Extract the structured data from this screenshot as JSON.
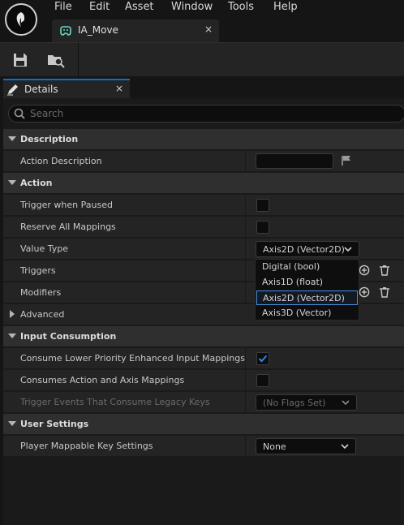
{
  "menu": [
    "File",
    "Edit",
    "Asset",
    "Window",
    "Tools",
    "Help"
  ],
  "asset_tab": {
    "label": "IA_Move",
    "close": "×"
  },
  "details_tab": {
    "label": "Details",
    "close": "×"
  },
  "search": {
    "placeholder": "Search"
  },
  "sections": {
    "description": "Description",
    "action": "Action",
    "advanced": "Advanced",
    "input_consumption": "Input Consumption",
    "user_settings": "User Settings"
  },
  "rows": {
    "action_description": "Action Description",
    "trigger_when_paused": "Trigger when Paused",
    "reserve_all_mappings": "Reserve All Mappings",
    "value_type": "Value Type",
    "triggers": "Triggers",
    "modifiers": "Modifiers",
    "consume_lower": "Consume Lower Priority Enhanced Input Mappings",
    "consumes_action_axis": "Consumes Action and Axis Mappings",
    "trigger_events_legacy": "Trigger Events That Consume Legacy Keys",
    "player_mappable": "Player Mappable Key Settings"
  },
  "values": {
    "action_description": "",
    "trigger_when_paused": false,
    "reserve_all_mappings": false,
    "value_type": "Axis2D (Vector2D)",
    "consume_lower": true,
    "consumes_action_axis": false,
    "trigger_events_legacy": "(No Flags Set)",
    "player_mappable": "None"
  },
  "value_type_options": [
    "Digital (bool)",
    "Axis1D (float)",
    "Axis2D (Vector2D)",
    "Axis3D (Vector)"
  ],
  "value_type_selected": "Axis2D (Vector2D)",
  "colors": {
    "accent": "#0070e0",
    "check": "#2b8ae6",
    "background": "#151515",
    "row": "#242424",
    "category": "#2f2f2f"
  }
}
